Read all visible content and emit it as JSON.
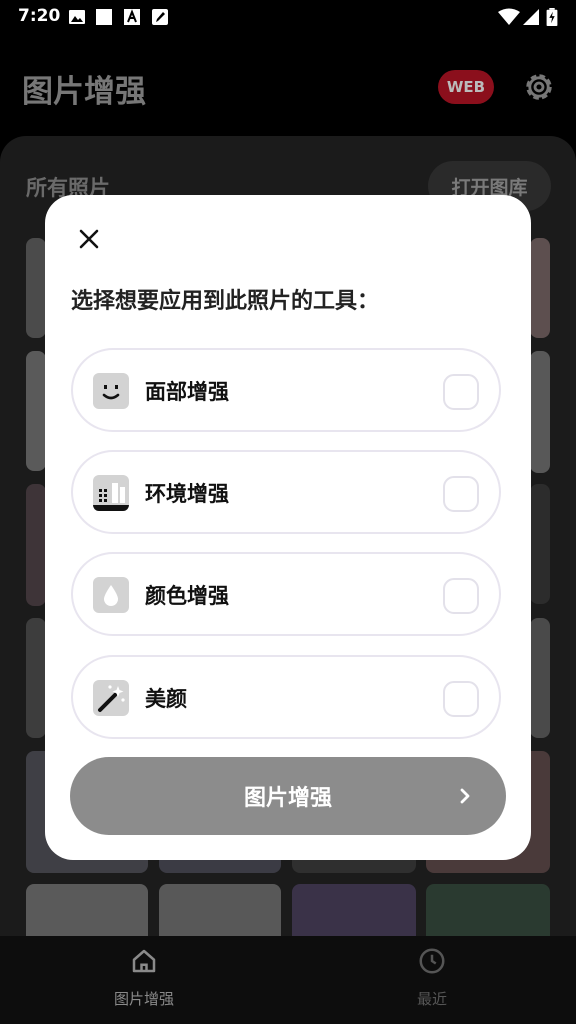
{
  "status_bar": {
    "time": "7:20"
  },
  "app": {
    "title": "图片增强",
    "web_badge": "WEB"
  },
  "gallery": {
    "section_title": "所有照片",
    "open_gallery_label": "打开图库"
  },
  "dialog": {
    "prompt": "选择想要应用到此照片的工具：",
    "options": [
      {
        "label": "面部增强",
        "icon": "face-icon",
        "checked": false
      },
      {
        "label": "环境增强",
        "icon": "building-icon",
        "checked": false
      },
      {
        "label": "颜色增强",
        "icon": "water-drop-icon",
        "checked": false
      },
      {
        "label": "美颜",
        "icon": "magic-wand-icon",
        "checked": false
      }
    ],
    "confirm_label": "图片增强"
  },
  "bottom_nav": [
    {
      "label": "图片增强",
      "icon": "home-icon",
      "active": true
    },
    {
      "label": "最近",
      "icon": "clock-icon",
      "active": false
    }
  ]
}
